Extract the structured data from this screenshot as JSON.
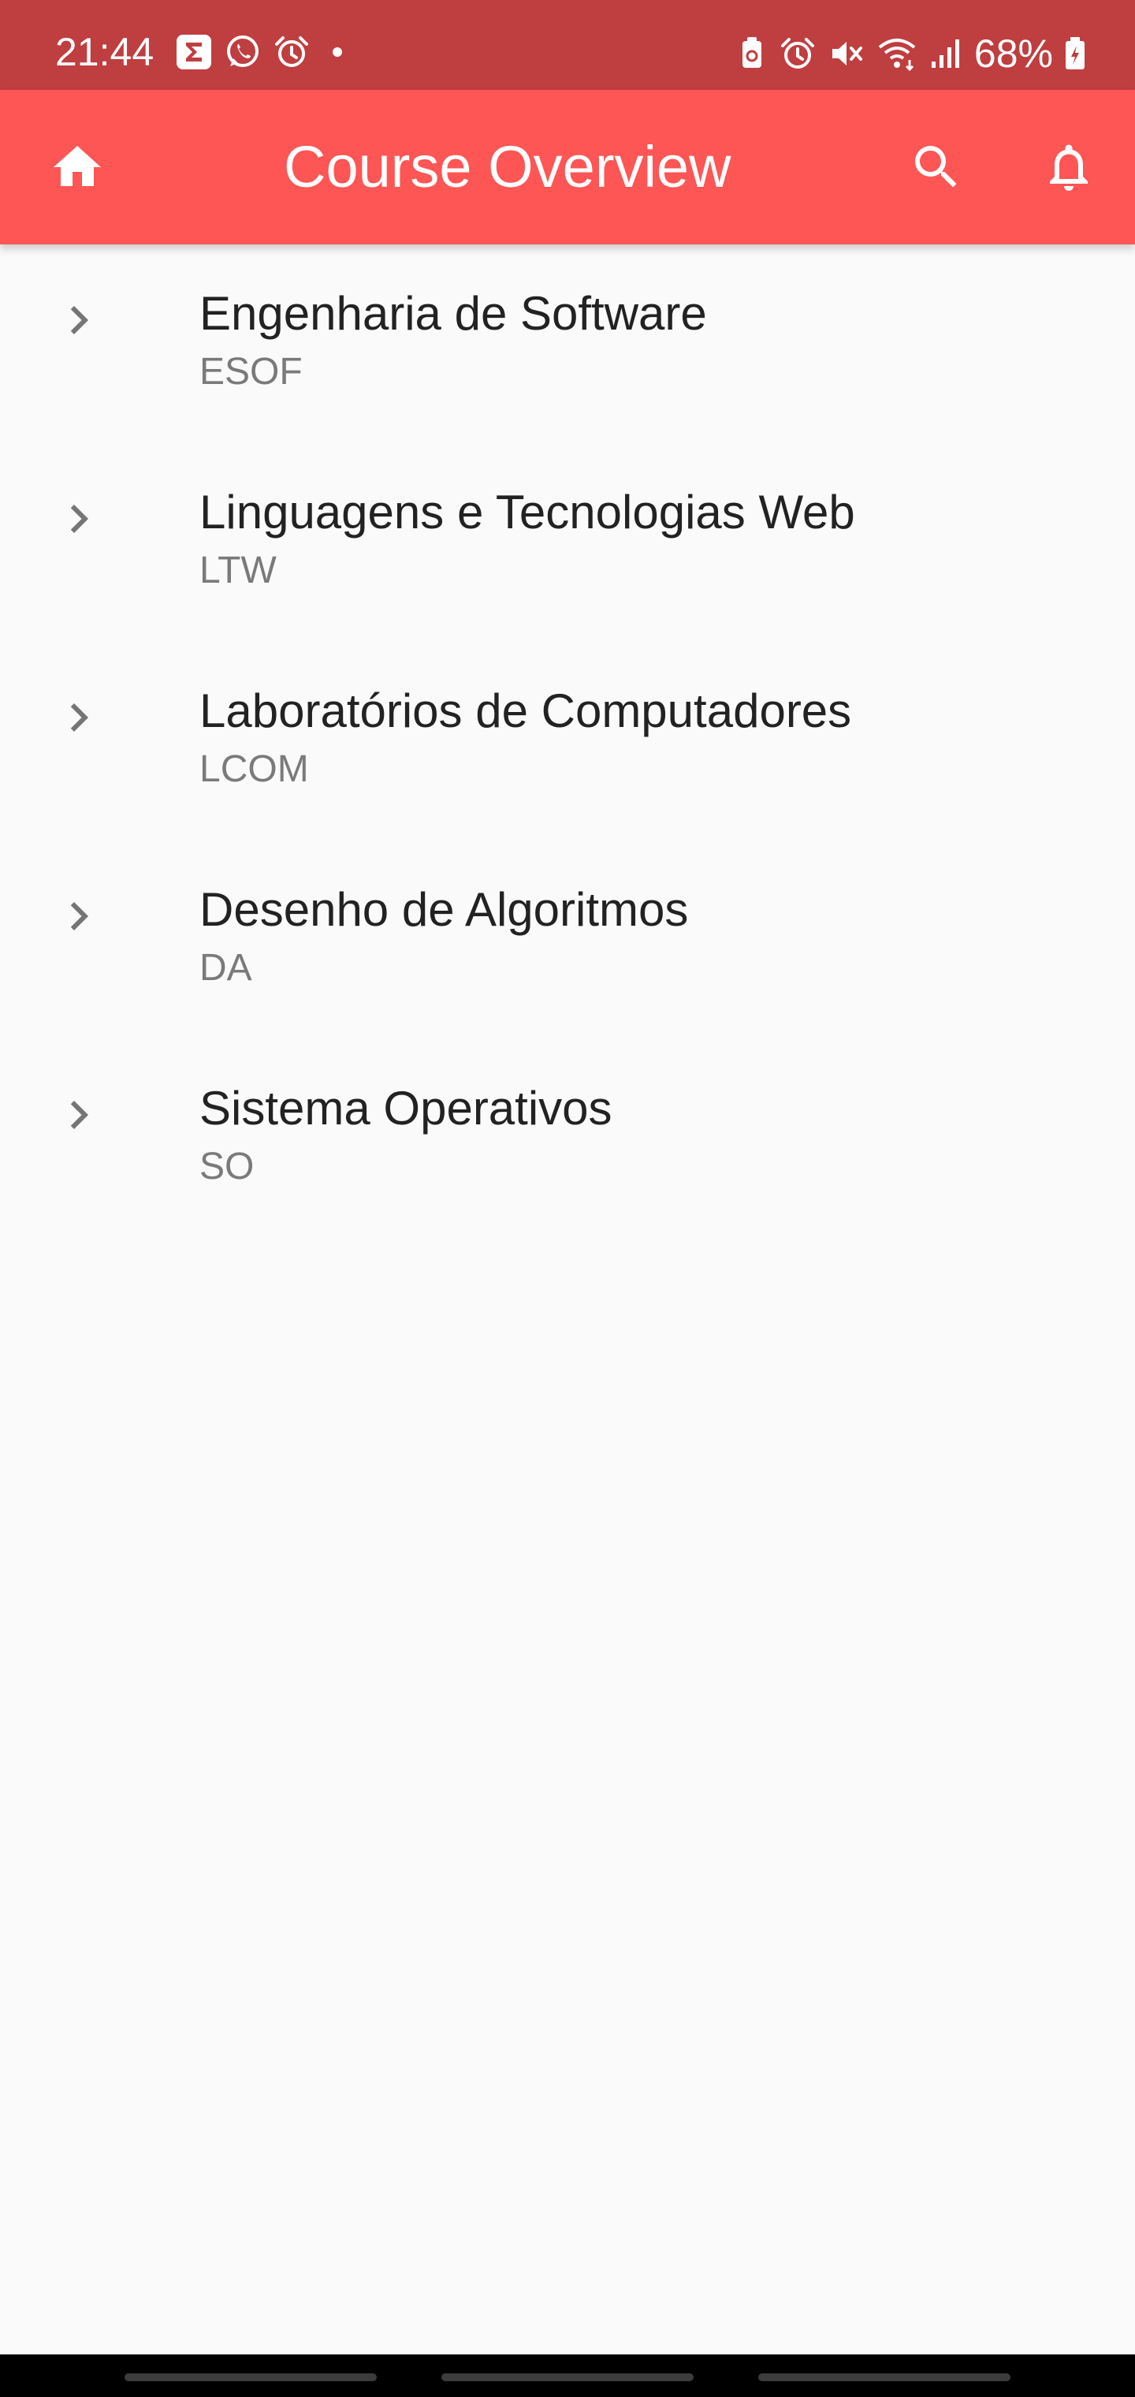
{
  "status_bar": {
    "time": "21:44",
    "battery": "68%",
    "left_icons": [
      "sigma-app-icon",
      "whatsapp-icon",
      "alarm-icon",
      "dot-icon"
    ],
    "right_icons": [
      "battery-saver-icon",
      "alarm-icon",
      "mute-icon",
      "wifi-icon",
      "signal-icon",
      "battery-charging-icon"
    ]
  },
  "app_bar": {
    "title": "Course Overview",
    "color": "#fe5555",
    "icons": [
      "home-icon",
      "search-icon",
      "bell-icon"
    ]
  },
  "courses": [
    {
      "name": "Engenharia de Software",
      "code": "ESOF"
    },
    {
      "name": "Linguagens e Tecnologias Web",
      "code": "LTW"
    },
    {
      "name": "Laboratórios de Computadores",
      "code": "LCOM"
    },
    {
      "name": "Desenho de Algoritmos",
      "code": "DA"
    },
    {
      "name": "Sistema Operativos",
      "code": "SO"
    }
  ],
  "colors": {
    "status_bar": "#bf3e40",
    "background": "#fafafa",
    "chevron": "#757575"
  }
}
